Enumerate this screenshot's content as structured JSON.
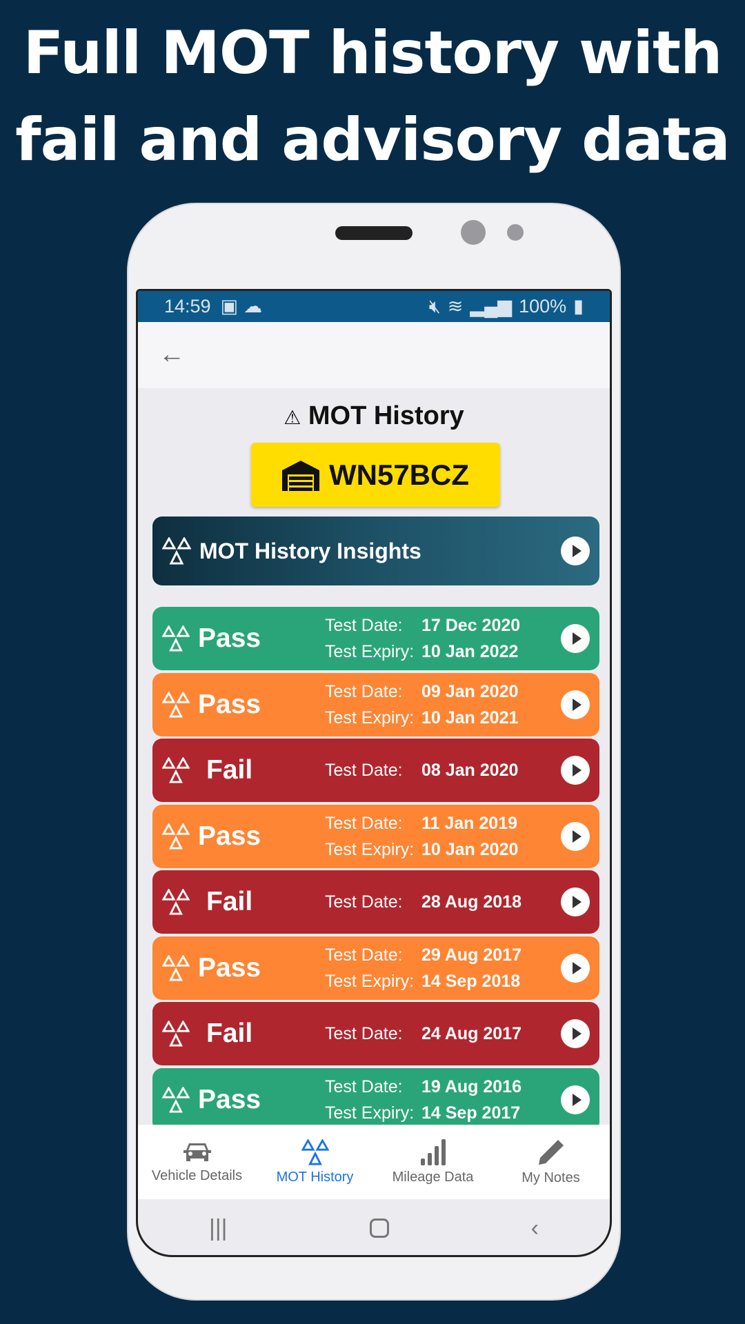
{
  "headline": [
    "Full MOT history with",
    "fail and advisory data"
  ],
  "status": {
    "time": "14:59",
    "battery": "100%"
  },
  "page_title": "MOT History",
  "plate": "WN57BCZ",
  "insights": "MOT History Insights",
  "labels": {
    "date": "Test Date:",
    "expiry": "Test Expiry:"
  },
  "colors": {
    "pass": "#2aa57a",
    "advisory": "#fd8534",
    "fail": "#b0262e"
  },
  "tests": [
    {
      "result": "Pass",
      "status": "pass",
      "date": "17 Dec 2020",
      "expiry": "10 Jan 2022"
    },
    {
      "result": "Pass",
      "status": "advisory",
      "date": "09 Jan 2020",
      "expiry": "10 Jan 2021"
    },
    {
      "result": "Fail",
      "status": "fail",
      "date": "08 Jan 2020"
    },
    {
      "result": "Pass",
      "status": "advisory",
      "date": "11 Jan 2019",
      "expiry": "10 Jan 2020"
    },
    {
      "result": "Fail",
      "status": "fail",
      "date": "28 Aug 2018"
    },
    {
      "result": "Pass",
      "status": "advisory",
      "date": "29 Aug 2017",
      "expiry": "14 Sep 2018"
    },
    {
      "result": "Fail",
      "status": "fail",
      "date": "24 Aug 2017"
    },
    {
      "result": "Pass",
      "status": "pass",
      "date": "19 Aug 2016",
      "expiry": "14 Sep 2017"
    }
  ],
  "nav": [
    {
      "label": "Vehicle Details",
      "icon": "car-icon"
    },
    {
      "label": "MOT History",
      "icon": "mot-triangles-icon",
      "active": true
    },
    {
      "label": "Mileage Data",
      "icon": "bar-signal-icon"
    },
    {
      "label": "My Notes",
      "icon": "pencil-icon"
    }
  ]
}
